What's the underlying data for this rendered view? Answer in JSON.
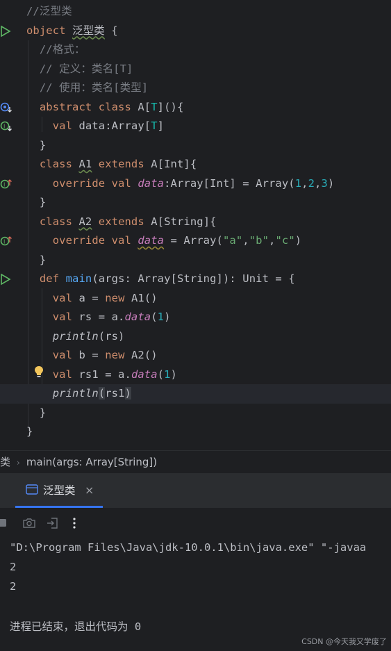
{
  "editor": {
    "lines": [
      "//泛型类",
      "object 泛型类 {",
      "//格式：",
      "// 定义：类名[T]",
      "// 使用：类名[类型]",
      "abstract class A[T](){",
      "val data:Array[T]",
      "}",
      "class A1 extends A[Int]{",
      "override val data:Array[Int] = Array(1,2,3)",
      "}",
      "class A2 extends A[String]{",
      "override val data = Array(\"a\",\"b\",\"c\")",
      "}",
      "def main(args: Array[String]): Unit = {",
      "val a = new A1()",
      "val rs = a.data(1)",
      "println(rs)",
      "val b = new A2()",
      "val rs1 = a.data(1)",
      "println(rs1)",
      "}",
      "}"
    ]
  },
  "breadcrumb": {
    "object": "类",
    "method": "main(args: Array[String])"
  },
  "tool_window": {
    "tab_label": "泛型类",
    "close_glyph": "×"
  },
  "console": {
    "lines": [
      "\"D:\\Program Files\\Java\\jdk-10.0.1\\bin\\java.exe\" \"-javaa",
      "2",
      "2",
      "",
      "进程已结束，退出代码为 0"
    ]
  },
  "watermark": "CSDN @今天我又学废了",
  "colors": {
    "background": "#1e1f22",
    "keyword": "#cf8e6d",
    "comment": "#7a7e85",
    "function": "#56a8f5",
    "number": "#2aacb8",
    "string": "#6aab73",
    "property": "#c77dbb",
    "accent": "#3574f0"
  },
  "icons": [
    "run-gutter-icon",
    "implemented-icon",
    "override-icon",
    "lightbulb-icon",
    "file-tab-icon",
    "stop-icon",
    "camera-icon",
    "exit-icon",
    "more-icon"
  ]
}
